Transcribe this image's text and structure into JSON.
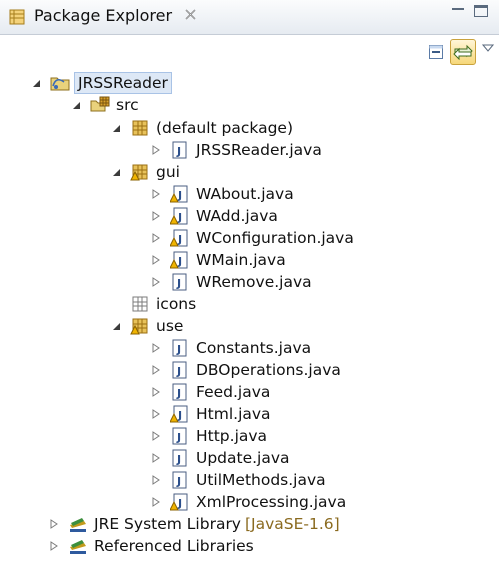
{
  "view": {
    "title": "Package Explorer",
    "close_symbol": "✕"
  },
  "toolbar": {
    "collapse_all": "collapse-all-icon",
    "link_with_editor": "link-with-editor-icon",
    "view_menu": "view-menu-icon"
  },
  "tree": {
    "project": "JRSSReader",
    "src": "src",
    "default_package": "(default package)",
    "default_files": [
      "JRSSReader.java"
    ],
    "gui": "gui",
    "gui_files": [
      "WAbout.java",
      "WAdd.java",
      "WConfiguration.java",
      "WMain.java",
      "WRemove.java"
    ],
    "icons": "icons",
    "use": "use",
    "use_files": [
      "Constants.java",
      "DBOperations.java",
      "Feed.java",
      "Html.java",
      "Http.java",
      "Update.java",
      "UtilMethods.java",
      "XmlProcessing.java"
    ],
    "jre_library": "JRE System Library",
    "jre_version": "[JavaSE-1.6]",
    "referenced_libraries": "Referenced Libraries"
  },
  "colors": {
    "selection": "#dde8f6",
    "decoration": "#8a6a1f",
    "warning": "#f0b400",
    "package": "#b8860b"
  }
}
